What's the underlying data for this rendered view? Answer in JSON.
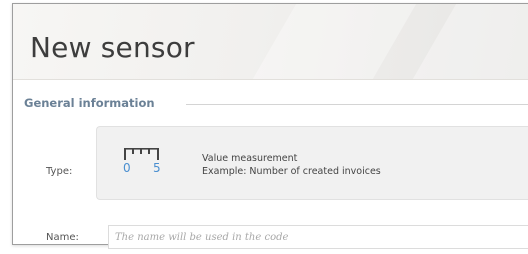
{
  "dialog": {
    "title": "New sensor"
  },
  "general_information": {
    "section_title": "General information",
    "type": {
      "label": "Type:",
      "gauge_min": "0",
      "gauge_max": "5",
      "icon": "value-gauge-icon",
      "title": "Value measurement",
      "example": "Example: Number of created invoices"
    },
    "name": {
      "label": "Name:",
      "value": "",
      "placeholder": "The name will be used in the code"
    }
  },
  "colors": {
    "section_title": "#6b8196",
    "gauge_numbers": "#4a8fd0",
    "type_box_bg": "#f1f1f1"
  }
}
